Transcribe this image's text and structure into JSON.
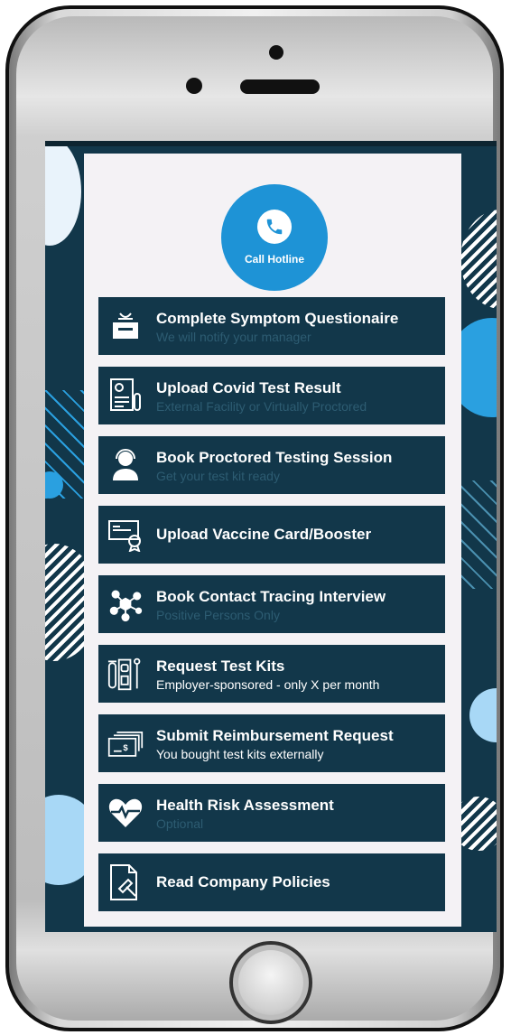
{
  "hotline": {
    "label": "Call Hotline",
    "icon": "phone-icon"
  },
  "menu": [
    {
      "title": "Complete Symptom Questionaire",
      "subtitle": "We will notify your manager",
      "icon": "tissue-box-icon"
    },
    {
      "title": "Upload Covid Test Result",
      "subtitle": "External Facility or Virtually Proctored",
      "icon": "test-report-icon"
    },
    {
      "title": "Book Proctored Testing Session",
      "subtitle": "Get your test kit ready",
      "icon": "support-agent-icon"
    },
    {
      "title": "Upload Vaccine Card/Booster",
      "subtitle": "",
      "icon": "vaccine-card-icon"
    },
    {
      "title": "Book Contact Tracing Interview",
      "subtitle": "Positive Persons Only",
      "icon": "network-icon"
    },
    {
      "title": "Request Test Kits",
      "subtitle": "Employer-sponsored - only X per month",
      "icon": "test-kit-icon"
    },
    {
      "title": "Submit Reimbursement Request",
      "subtitle": "You bought test kits externally",
      "icon": "money-icon"
    },
    {
      "title": "Health Risk Assessment",
      "subtitle": "Optional",
      "icon": "heart-pulse-icon"
    },
    {
      "title": "Read Company Policies",
      "subtitle": "",
      "icon": "policy-document-icon"
    }
  ],
  "colors": {
    "screen_bg": "#12374a",
    "panel_bg": "#f4f2f5",
    "hotline_blue": "#1e93d6",
    "item_bg": "#12374a",
    "subtitle_dim": "#2d5c72"
  }
}
